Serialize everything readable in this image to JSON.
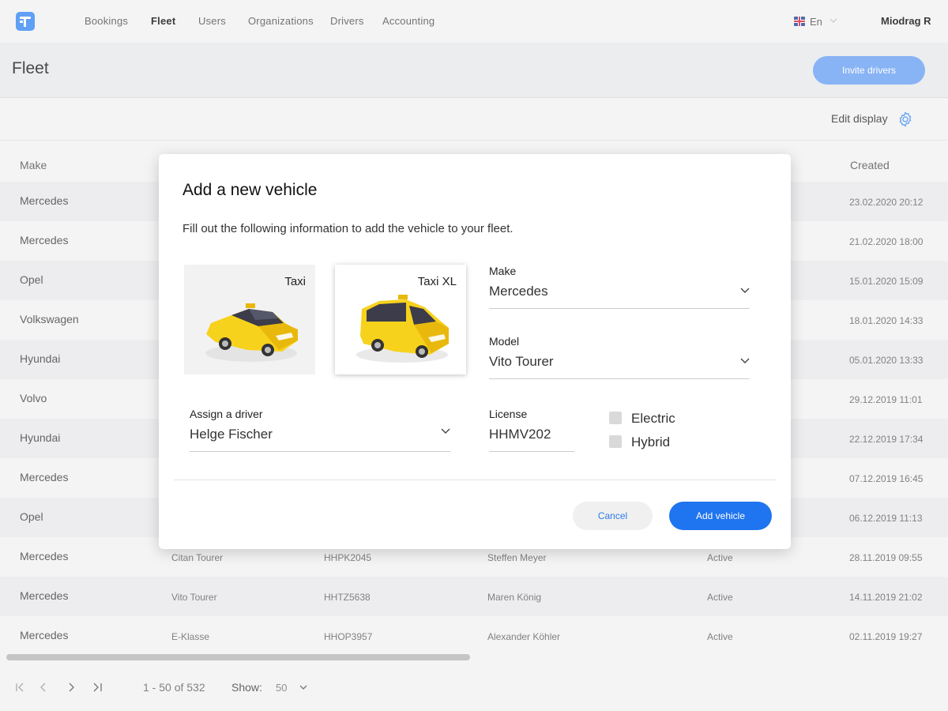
{
  "nav": {
    "items": [
      "Bookings",
      "Fleet",
      "Users",
      "Organizations",
      "Drivers",
      "Accounting"
    ],
    "active": "Fleet",
    "language": "En",
    "user": "Miodrag  R"
  },
  "header": {
    "title": "Fleet",
    "invite_label": "Invite drivers"
  },
  "toolbar": {
    "edit_display_label": "Edit display"
  },
  "table": {
    "headers": {
      "make": "Make",
      "created": "Created"
    },
    "rows": [
      {
        "make": "Mercedes",
        "model": "",
        "license": "",
        "driver": "",
        "status": "",
        "created": "23.02.2020 20:12"
      },
      {
        "make": "Mercedes",
        "model": "",
        "license": "",
        "driver": "",
        "status": "",
        "created": "21.02.2020 18:00"
      },
      {
        "make": "Opel",
        "model": "",
        "license": "",
        "driver": "",
        "status": "",
        "created": "15.01.2020 15:09"
      },
      {
        "make": "Volkswagen",
        "model": "",
        "license": "",
        "driver": "",
        "status": "",
        "created": "18.01.2020 14:33"
      },
      {
        "make": "Hyundai",
        "model": "",
        "license": "",
        "driver": "",
        "status": "",
        "created": "05.01.2020 13:33"
      },
      {
        "make": "Volvo",
        "model": "",
        "license": "",
        "driver": "",
        "status": "",
        "created": "29.12.2019 11:01"
      },
      {
        "make": "Hyundai",
        "model": "",
        "license": "",
        "driver": "",
        "status": "",
        "created": "22.12.2019 17:34"
      },
      {
        "make": "Mercedes",
        "model": "",
        "license": "",
        "driver": "",
        "status": "",
        "created": "07.12.2019 16:45"
      },
      {
        "make": "Opel",
        "model": "",
        "license": "",
        "driver": "",
        "status": "",
        "created": "06.12.2019 11:13"
      },
      {
        "make": "Mercedes",
        "model": "Citan Tourer",
        "license": "HHPK2045",
        "driver": "Steffen Meyer",
        "status": "Active",
        "created": "28.11.2019 09:55"
      },
      {
        "make": "Mercedes",
        "model": "Vito Tourer",
        "license": "HHTZ5638",
        "driver": "Maren König",
        "status": "Active",
        "created": "14.11.2019 21:02"
      },
      {
        "make": "Mercedes",
        "model": "E-Klasse",
        "license": "HHOP3957",
        "driver": "Alexander Köhler",
        "status": "Active",
        "created": "02.11.2019 19:27"
      }
    ]
  },
  "pagination": {
    "range": "1 - 50 of 532",
    "show_label": "Show:",
    "show_value": "50"
  },
  "modal": {
    "title": "Add a new vehicle",
    "description": "Fill out the following information to add the vehicle to your fleet.",
    "vehicle_types": [
      {
        "label": "Taxi",
        "selected": false
      },
      {
        "label": "Taxi XL",
        "selected": true
      }
    ],
    "make": {
      "label": "Make",
      "value": "Mercedes"
    },
    "model": {
      "label": "Model",
      "value": "Vito Tourer"
    },
    "driver": {
      "label": "Assign a driver",
      "value": "Helge Fischer"
    },
    "license": {
      "label": "License",
      "value": "HHMV202"
    },
    "electric_label": "Electric",
    "hybrid_label": "Hybrid",
    "cancel_label": "Cancel",
    "add_label": "Add vehicle"
  },
  "colors": {
    "accent": "#1f74ef",
    "invite_button": "#6ea3f2",
    "taxi_yellow": "#f7d21c"
  }
}
